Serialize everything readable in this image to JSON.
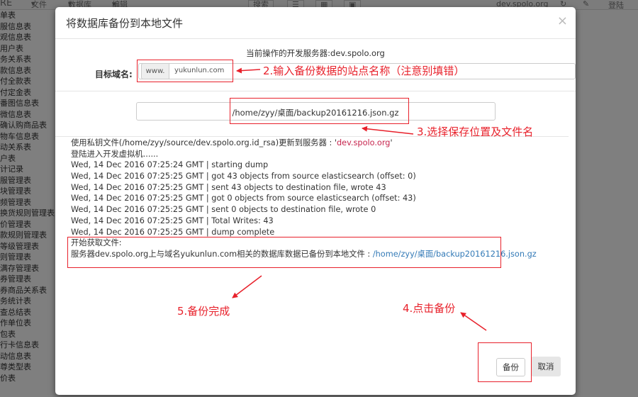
{
  "topbar": {
    "brand": "RE",
    "menu_file": "文件",
    "menu_db": "数据库",
    "menu_edit": "编辑",
    "search_label": "搜索",
    "server_label": "dev.spolo.org",
    "login_label": "登陆"
  },
  "sidebar": {
    "items": [
      "单表",
      "服信息表",
      "观信息表",
      "用户表",
      "务关系表",
      "款信息表",
      "付全款表",
      "付定金表",
      "番图信息表",
      "微信息表",
      "确认购商品表",
      "物车信息表",
      "动关系表",
      "户表",
      "计记录",
      "服管理表",
      "块管理表",
      "频管理表",
      "换货规则管理表",
      "价管理表",
      "款规则管理表",
      "等级管理表",
      "则管理表",
      "满存管理表",
      "券管理表",
      "券商品关系表",
      "务统计表",
      "查总结表",
      "作单位表",
      "包表",
      "行卡信息表",
      "动信息表",
      "尊类型表",
      "价表"
    ]
  },
  "modal": {
    "title": "将数据库备份到本地文件",
    "close_label": "×",
    "server_line": "当前操作的开发服务器:dev.spolo.org",
    "domain_label": "目标域名:",
    "domain_prefix": "www.",
    "domain_value": "yukunlun.com",
    "path_value": "/home/zyy/桌面/backup20161216.json.gz",
    "log": {
      "line1_prefix": "使用私钥文件(/home/zyy/source/dev.spolo.org.id_rsa)更新到服务器 : '",
      "line1_server": "dev.spolo.org",
      "line1_suffix": "'",
      "line2": "登陆进入开发虚拟机......",
      "line3": "Wed, 14 Dec 2016 07:25:24 GMT | starting dump",
      "line4": "Wed, 14 Dec 2016 07:25:25 GMT | got 43 objects from source elasticsearch (offset: 0)",
      "line5": "Wed, 14 Dec 2016 07:25:25 GMT | sent 43 objects to destination file, wrote 43",
      "line6": "Wed, 14 Dec 2016 07:25:25 GMT | got 0 objects from source elasticsearch (offset: 43)",
      "line7": "Wed, 14 Dec 2016 07:25:25 GMT | sent 0 objects to destination file, wrote 0",
      "line8": "Wed, 14 Dec 2016 07:25:25 GMT | Total Writes: 43",
      "line9": "Wed, 14 Dec 2016 07:25:25 GMT | dump complete",
      "line10": "开始获取文件:",
      "line11_prefix": "服务器dev.spolo.org上与域名yukunlun.com相关的数据库数据已备份到本地文件 : ",
      "line11_link": "/home/zyy/桌面/backup20161216.json.gz"
    },
    "backup_label": "备份",
    "cancel_label": "取消"
  },
  "annotations": {
    "step2": "2.输入备份数据的站点名称（注意别填错）",
    "step3": "3.选择保存位置及文件名",
    "step4": "4.点击备份",
    "step5": "5.备份完成",
    "color": "#e8212b"
  }
}
